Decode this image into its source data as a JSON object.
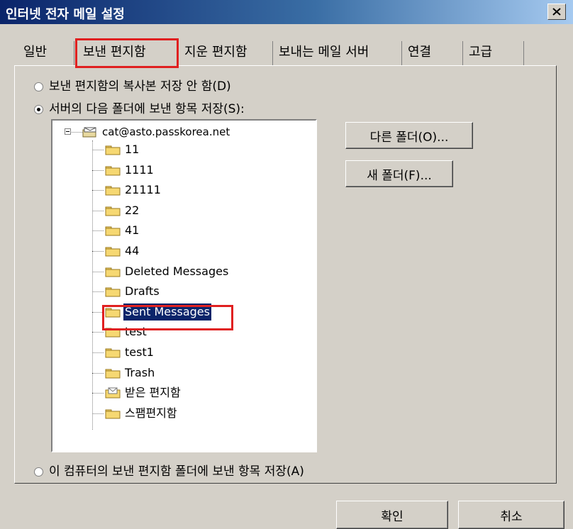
{
  "window": {
    "title": "인터넷 전자 메일 설정"
  },
  "tabs": [
    {
      "label": "일반"
    },
    {
      "label": "보낸 편지함",
      "active": true
    },
    {
      "label": "지운 편지함"
    },
    {
      "label": "보내는 메일 서버"
    },
    {
      "label": "연결"
    },
    {
      "label": "고급"
    }
  ],
  "options": {
    "no_copy": "보낸 편지함의 복사본 저장 안 함(D)",
    "save_server": "서버의 다음 폴더에 보낸 항목 저장(S):",
    "save_local": "이 컴퓨터의 보낸 편지함 폴더에 보낸 항목 저장(A)",
    "selected": "save_server"
  },
  "tree": {
    "account": "cat@asto.passkorea.net",
    "folders": [
      {
        "label": "11"
      },
      {
        "label": "1111"
      },
      {
        "label": "21111"
      },
      {
        "label": "22"
      },
      {
        "label": "41"
      },
      {
        "label": "44"
      },
      {
        "label": "Deleted Messages"
      },
      {
        "label": "Drafts"
      },
      {
        "label": "Sent Messages",
        "selected": true
      },
      {
        "label": "test"
      },
      {
        "label": "test1"
      },
      {
        "label": "Trash"
      },
      {
        "label": "받은 편지함",
        "icon": "inbox-icon"
      },
      {
        "label": "스팸편지함"
      }
    ]
  },
  "buttons": {
    "other_folder": "다른 폴더(O)...",
    "new_folder": "새 폴더(F)...",
    "ok": "확인",
    "cancel": "취소"
  },
  "colors": {
    "highlight": "#e02020",
    "selection": "#0a246a"
  }
}
